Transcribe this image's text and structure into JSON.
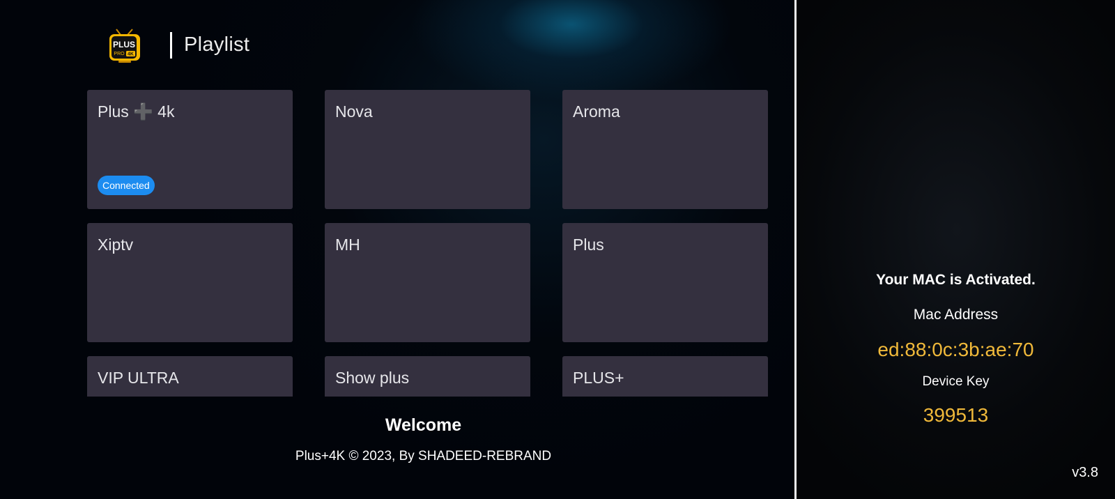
{
  "header": {
    "logo": {
      "icon": "plus-pro-4k-logo-icon",
      "text_top": "PLUS",
      "text_bottom": "PRO 4K",
      "accent_color": "#f5b800"
    },
    "title": "Playlist"
  },
  "playlists": [
    {
      "name": "Plus ➕ 4k",
      "badge": "Connected"
    },
    {
      "name": "Nova"
    },
    {
      "name": "Aroma"
    },
    {
      "name": "Xiptv"
    },
    {
      "name": "MH"
    },
    {
      "name": "Plus"
    },
    {
      "name": "VIP ULTRA"
    },
    {
      "name": "Show plus"
    },
    {
      "name": "PLUS+"
    }
  ],
  "footer": {
    "welcome": "Welcome",
    "copyright": "Plus+4K © 2023, By SHADEED-REBRAND"
  },
  "device": {
    "status": "Your MAC is Activated.",
    "mac_label": "Mac Address",
    "mac_value": "ed:88:0c:3b:ae:70",
    "key_label": "Device Key",
    "key_value": "399513",
    "version": "v3.8"
  },
  "colors": {
    "tile_bg": "#34303f",
    "badge_bg": "#1c8cf0",
    "value_accent": "#f0b93a"
  }
}
